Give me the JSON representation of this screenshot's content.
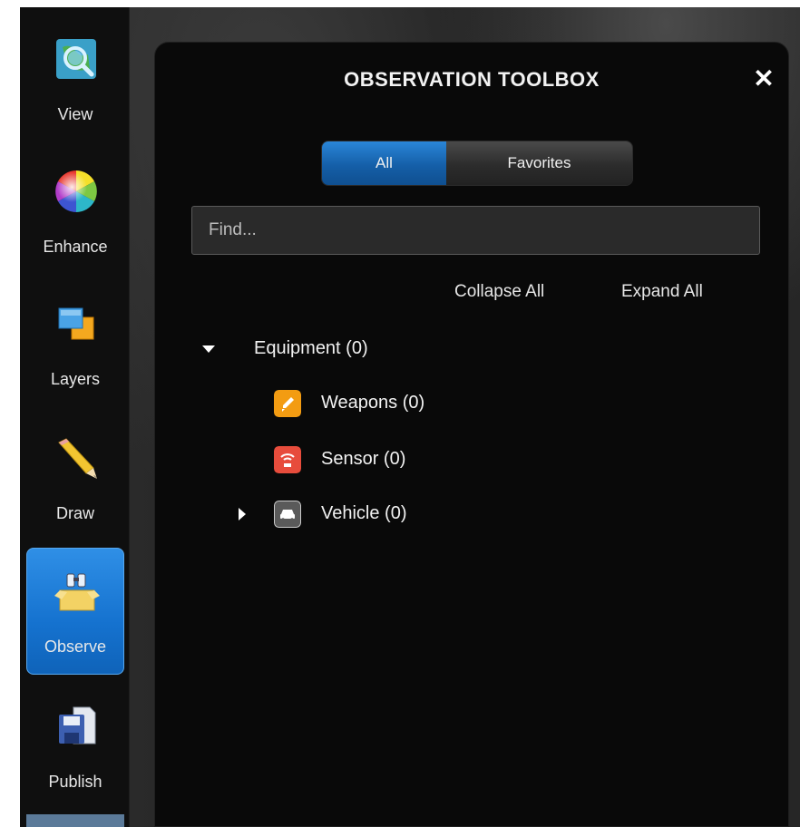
{
  "sidebar": {
    "items": [
      {
        "label": "View",
        "icon": "globe-magnifier-icon",
        "active": false
      },
      {
        "label": "Enhance",
        "icon": "color-wheel-icon",
        "active": false
      },
      {
        "label": "Layers",
        "icon": "layers-icon",
        "active": false
      },
      {
        "label": "Draw",
        "icon": "pencil-icon",
        "active": false
      },
      {
        "label": "Observe",
        "icon": "binoculars-box-icon",
        "active": true
      },
      {
        "label": "Publish",
        "icon": "save-document-icon",
        "active": false
      }
    ]
  },
  "panel": {
    "title": "OBSERVATION TOOLBOX",
    "close_label": "✕",
    "tabs": [
      {
        "label": "All",
        "selected": true
      },
      {
        "label": "Favorites",
        "selected": false
      }
    ],
    "search": {
      "placeholder": "Find...",
      "value": ""
    },
    "collapse_all_label": "Collapse All",
    "expand_all_label": "Expand All",
    "tree": {
      "label": "Equipment (0)",
      "expanded": true,
      "children": [
        {
          "label": "Weapons (0)",
          "icon": "weapons-icon",
          "color": "#f39c12"
        },
        {
          "label": "Sensor (0)",
          "icon": "sensor-icon",
          "color": "#e74c3c"
        },
        {
          "label": "Vehicle (0)",
          "icon": "vehicle-icon",
          "color": "#555555",
          "expandable": true,
          "expanded": false
        }
      ]
    }
  },
  "colors": {
    "accent": "#1e7fd8",
    "panel_bg": "#090909",
    "sidebar_bg": "#0f0f0f"
  }
}
